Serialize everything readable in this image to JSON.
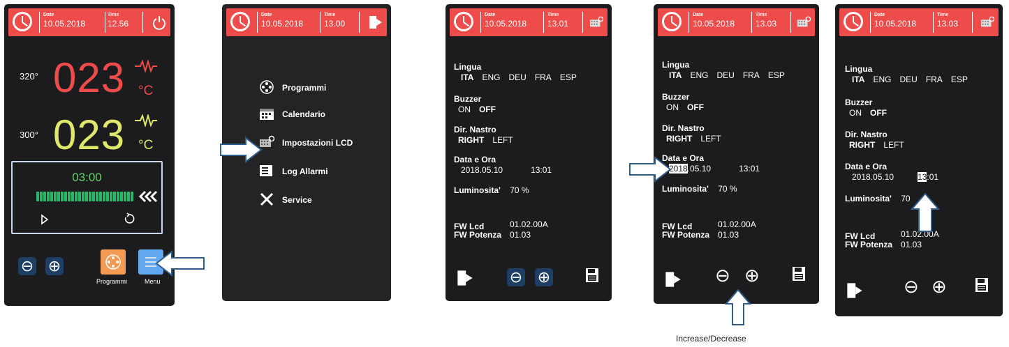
{
  "screen1": {
    "date_label": "Date",
    "date": "10.05.2018",
    "time_label": "Time",
    "time": "12.56",
    "upper_setpoint": "320°",
    "upper_temp": "023",
    "lower_setpoint": "300°",
    "lower_temp": "023",
    "unit": "°C",
    "timer": "03:00",
    "timer_progress": 1.0,
    "minus_symbol": "⊖",
    "plus_symbol": "⊕",
    "programs_label": "Programmi",
    "menu_label": "Menu"
  },
  "screen2": {
    "date_label": "Date",
    "date": "10.05.2018",
    "time_label": "Time",
    "time": "13.00",
    "menu": [
      "Programmi",
      "Calendario",
      "Impostazioni LCD",
      "Log Allarmi",
      "Service"
    ]
  },
  "screen3": {
    "date_label": "Date",
    "date": "10.05.2018",
    "time_label": "Time",
    "time": "13.01",
    "dt_date": "2018.05.10",
    "dt_time": "13:01"
  },
  "screen4": {
    "date_label": "Date",
    "date": "10.05.2018",
    "time_label": "Time",
    "time": "13.03",
    "year": "2018",
    "month_day": ".05.10",
    "dt_time": "13:01"
  },
  "screen5": {
    "date_label": "Date",
    "date": "10.05.2018",
    "time_label": "Time",
    "time": "13.03",
    "dt_date": "2018.05.10",
    "hour": "13",
    "minutes": ":01",
    "lum_partial": "70"
  },
  "settings": {
    "lang_title": "Lingua",
    "lang_options": [
      "ITA",
      "ENG",
      "DEU",
      "FRA",
      "ESP"
    ],
    "buzzer_title": "Buzzer",
    "buzzer_options": [
      "ON",
      "OFF"
    ],
    "dir_title": "Dir. Nastro",
    "dir_options": [
      "RIGHT",
      "LEFT"
    ],
    "dt_title": "Data e Ora",
    "lum_title": "Luminosita'",
    "lum_value": "70 %",
    "fw_lcd_label": "FW Lcd",
    "fw_lcd_value": "01.02.00A",
    "fw_power_label": "FW Potenza",
    "fw_power_value": "01.03",
    "minus_symbol": "⊖",
    "plus_symbol": "⊕"
  },
  "caption": "Increase/Decrease"
}
